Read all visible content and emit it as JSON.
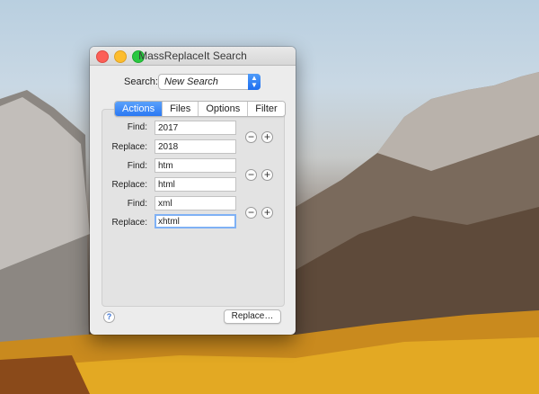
{
  "window": {
    "title": "MassReplaceIt Search"
  },
  "search": {
    "label": "Search:",
    "value": "New Search"
  },
  "tabs": [
    {
      "label": "Actions",
      "active": true
    },
    {
      "label": "Files",
      "active": false
    },
    {
      "label": "Options",
      "active": false
    },
    {
      "label": "Filter",
      "active": false
    }
  ],
  "pairs": [
    {
      "find_label": "Find:",
      "find_value": "2017",
      "replace_label": "Replace:",
      "replace_value": "2018"
    },
    {
      "find_label": "Find:",
      "find_value": "htm",
      "replace_label": "Replace:",
      "replace_value": "html"
    },
    {
      "find_label": "Find:",
      "find_value": "xml",
      "replace_label": "Replace:",
      "replace_value": "xhtml"
    }
  ],
  "controls": {
    "minus": "−",
    "plus": "+"
  },
  "footer": {
    "help": "?",
    "replace_button": "Replace…"
  },
  "colors": {
    "accent": "#2a78f3",
    "focus_ring": "#7fb1f5"
  }
}
